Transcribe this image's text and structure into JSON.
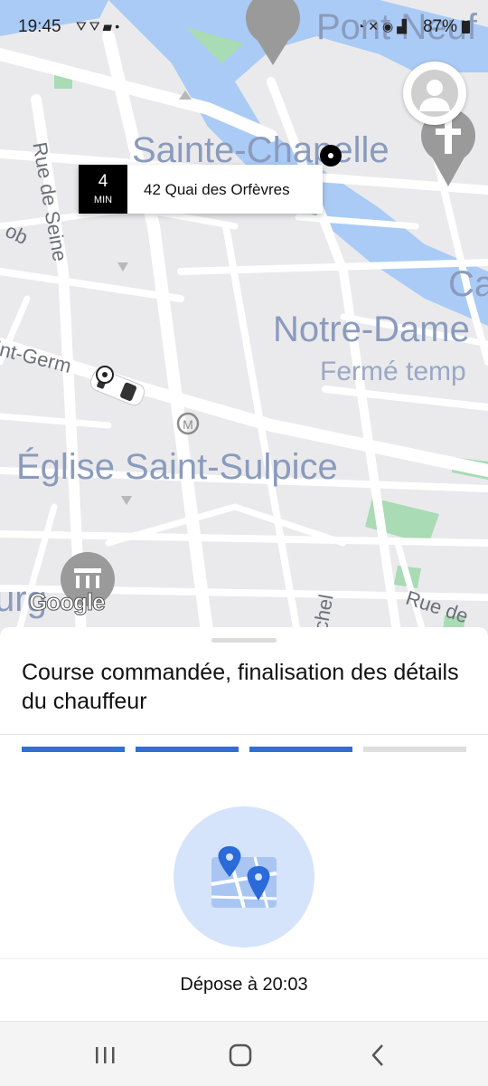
{
  "status_bar": {
    "time": "19:45",
    "battery": "87%",
    "left_icons": [
      "notification-icon",
      "notification-icon",
      "message-icon",
      "dot-icon"
    ],
    "right_icons": [
      "alarm-icon",
      "mute-icon",
      "location-icon",
      "signal-4g-icon",
      "battery-icon"
    ]
  },
  "map": {
    "labels": {
      "pont_neuf": "Pont Neuf",
      "sainte_chapelle": "Sainte-Chapelle",
      "notre_dame": "Notre-Dame",
      "ferme_temp": "Fermé temp",
      "eglise_saint_sulpice": "Église Saint-Sulpice",
      "rue_de_seine": "Rue de Seine",
      "saint_germain": "int-Germ",
      "rue_de": "Rue de",
      "ob": "ob",
      "ca": "Ca",
      "urg": "urg",
      "chel": "chel"
    },
    "eta": {
      "minutes": "4",
      "unit": "MIN",
      "address": "42 Quai des Orfèvres"
    },
    "attribution": "Google",
    "colors": {
      "water": "#aacbf5",
      "road": "#ffffff",
      "land": "#eaeaec",
      "park": "#a9dbb4"
    }
  },
  "sheet": {
    "status_title": "Course commandée, finalisation des détails du chauffeur",
    "progress": {
      "completed_steps": 3,
      "total_steps": 4,
      "accent": "#2f6fd7"
    },
    "illustration": "map-pins-icon",
    "dropoff_text": "Dépose à 20:03"
  },
  "nav_bar": {
    "recent": "recent-apps-icon",
    "home": "home-icon",
    "back": "back-icon"
  }
}
